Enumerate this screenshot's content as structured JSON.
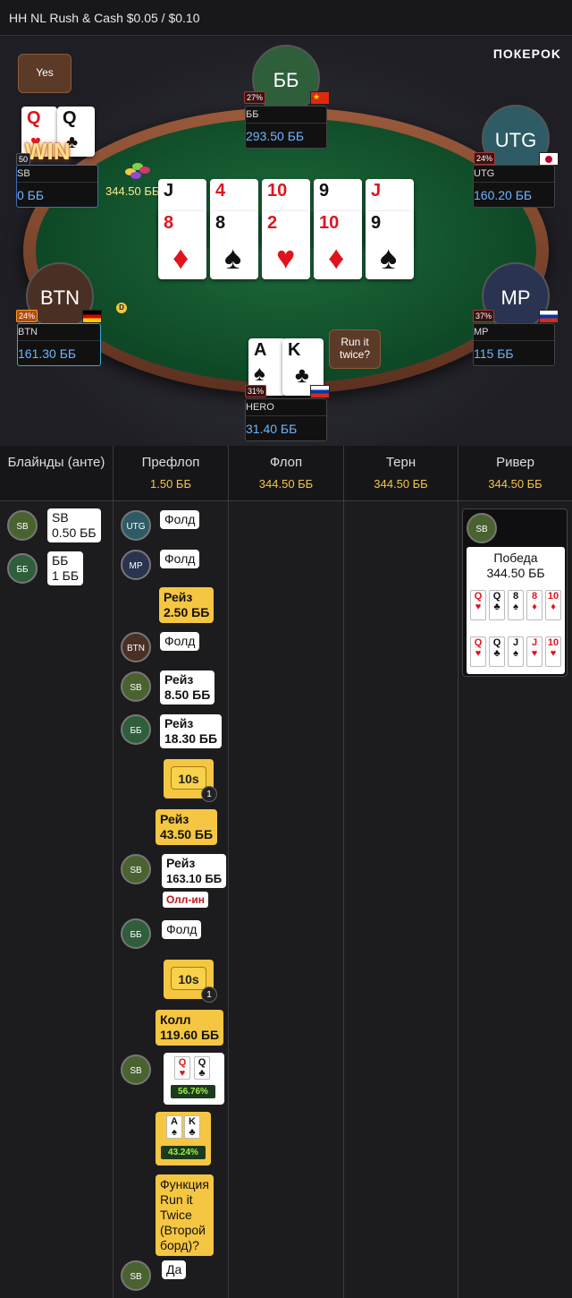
{
  "header": {
    "title": "HH NL Rush & Cash $0.05 / $0.10"
  },
  "table": {
    "logo": "ПОКЕРOK",
    "pot": "344.50 ББ",
    "dealer": "D",
    "seats": {
      "bb": {
        "label": "ББ",
        "name": "ББ",
        "stack": "293.50 ББ",
        "pct": "27%"
      },
      "utg": {
        "label": "UTG",
        "name": "UTG",
        "stack": "160.20 ББ",
        "pct": "24%"
      },
      "mp": {
        "label": "MP",
        "name": "MP",
        "stack": "115 ББ",
        "pct": "37%"
      },
      "btn": {
        "label": "BTN",
        "name": "BTN",
        "stack": "161.30 ББ",
        "pct": "24%"
      },
      "sb": {
        "name": "SB",
        "stack": "0 ББ",
        "pct": "50",
        "win": "WIN",
        "cards": [
          {
            "r": "Q",
            "s": "♥",
            "c": "red"
          },
          {
            "r": "Q",
            "s": "♣",
            "c": "blk"
          }
        ]
      },
      "hero": {
        "name": "HERO",
        "stack": "31.40 ББ",
        "pct": "31%",
        "cards": [
          {
            "r": "A",
            "s": "♠",
            "c": "blk"
          },
          {
            "r": "K",
            "s": "♣",
            "c": "blk"
          }
        ]
      }
    },
    "bubbles": {
      "sb": "Yes",
      "hero": "Run it twice?"
    },
    "board_top": [
      {
        "r": "J",
        "s": "♠",
        "c": "blk"
      },
      {
        "r": "4",
        "s": "♥",
        "c": "red"
      },
      {
        "r": "10",
        "s": "♥",
        "c": "red"
      },
      {
        "r": "9",
        "s": "♠",
        "c": "blk"
      },
      {
        "r": "J",
        "s": "♥",
        "c": "red"
      }
    ],
    "board_bottom": [
      {
        "r": "8",
        "s": "♦",
        "c": "red"
      },
      {
        "r": "8",
        "s": "♠",
        "c": "blk"
      },
      {
        "r": "2",
        "s": "♥",
        "c": "red"
      },
      {
        "r": "10",
        "s": "♦",
        "c": "red"
      },
      {
        "r": "9",
        "s": "♠",
        "c": "blk"
      }
    ]
  },
  "history": {
    "cols": [
      {
        "title": "Блайнды (анте)",
        "value": ""
      },
      {
        "title": "Префлоп",
        "value": "1.50 ББ"
      },
      {
        "title": "Флоп",
        "value": "344.50 ББ"
      },
      {
        "title": "Терн",
        "value": "344.50 ББ"
      },
      {
        "title": "Ривер",
        "value": "344.50 ББ"
      }
    ],
    "blinds": [
      {
        "pos": "SB",
        "line1": "SB",
        "line2": "0.50 ББ"
      },
      {
        "pos": "ББ",
        "line1": "ББ",
        "line2": "1 ББ"
      }
    ],
    "preflop": {
      "a1": {
        "pos": "UTG",
        "text": "Фолд"
      },
      "a2": {
        "pos": "MP",
        "text": "Фолд"
      },
      "a3": {
        "line1": "Рейз",
        "line2": "2.50 ББ"
      },
      "a4": {
        "pos": "BTN",
        "text": "Фолд"
      },
      "a5": {
        "pos": "SB",
        "line1": "Рейз",
        "line2": "8.50 ББ"
      },
      "a6": {
        "pos": "ББ",
        "line1": "Рейз",
        "line2": "18.30 ББ"
      },
      "t1": {
        "label": "10s",
        "badge": "1"
      },
      "a7": {
        "line1": "Рейз",
        "line2": "43.50 ББ"
      },
      "a8": {
        "pos": "SB",
        "line1": "Рейз",
        "line2": "163.10 ББ",
        "tag": "Олл-ин"
      },
      "a9": {
        "pos": "ББ",
        "text": "Фолд"
      },
      "t2": {
        "label": "10s",
        "badge": "1"
      },
      "a10": {
        "line1": "Колл",
        "line2": "119.60 ББ"
      },
      "a11": {
        "pos": "SB",
        "equity": "56.76%"
      },
      "a12": {
        "equity": "43.24%"
      },
      "a13": {
        "line1": "Функция",
        "line2": "Run it",
        "line3": "Twice",
        "line4": "(Второй",
        "line5": "борд)?"
      },
      "a14": {
        "pos": "SB",
        "text": "Да"
      }
    },
    "river": {
      "pos": "SB",
      "line1": "Победа",
      "line2": "344.50 ББ",
      "row1": [
        {
          "r": "Q",
          "s": "♥",
          "c": "red"
        },
        {
          "r": "Q",
          "s": "♣",
          "c": "blk"
        },
        {
          "r": "8",
          "s": "♠",
          "c": "blk"
        },
        {
          "r": "8",
          "s": "♦",
          "c": "red"
        },
        {
          "r": "10",
          "s": "♦",
          "c": "red"
        }
      ],
      "row2": [
        {
          "r": "Q",
          "s": "♥",
          "c": "red"
        },
        {
          "r": "Q",
          "s": "♣",
          "c": "blk"
        },
        {
          "r": "J",
          "s": "♠",
          "c": "blk"
        },
        {
          "r": "J",
          "s": "♥",
          "c": "red"
        },
        {
          "r": "10",
          "s": "♥",
          "c": "red"
        }
      ]
    }
  },
  "colors": {
    "accent": "#f5c642",
    "stack": "#6db4ff"
  }
}
